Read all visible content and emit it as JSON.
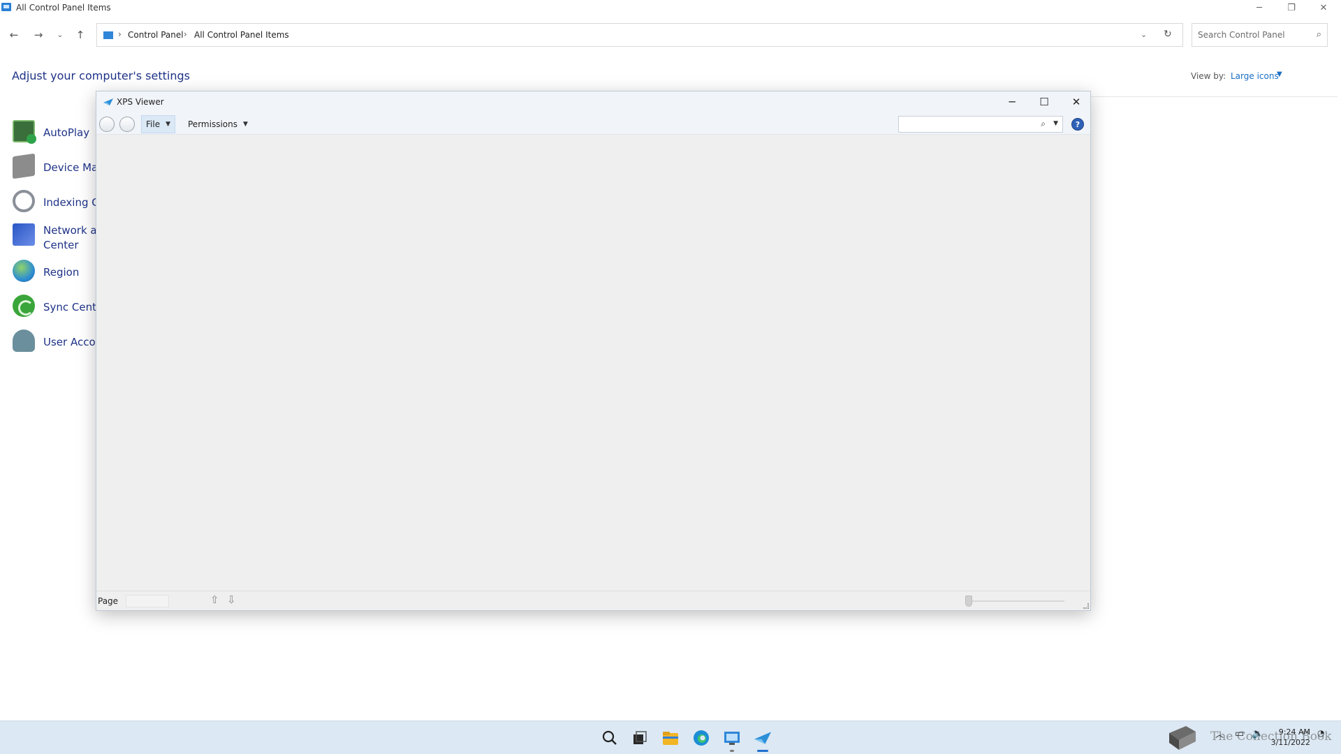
{
  "control_panel": {
    "window_title": "All Control Panel Items",
    "breadcrumb": [
      "Control Panel",
      "All Control Panel Items"
    ],
    "search_placeholder": "Search Control Panel",
    "heading": "Adjust your computer's settings",
    "view_by_label": "View by:",
    "view_by_value": "Large icons",
    "items": [
      {
        "label": "AutoPlay",
        "icon": "autoplay-icon"
      },
      {
        "label": "Device Mar",
        "icon": "device-manager-icon"
      },
      {
        "label": "Indexing O",
        "icon": "indexing-options-icon"
      },
      {
        "label": "Network ar",
        "label2": "Center",
        "icon": "network-center-icon"
      },
      {
        "label": "Region",
        "icon": "region-icon"
      },
      {
        "label": "Sync Cente",
        "icon": "sync-center-icon"
      },
      {
        "label": "User Accou",
        "icon": "user-accounts-icon"
      }
    ]
  },
  "xps_viewer": {
    "title": "XPS Viewer",
    "menu": {
      "file": "File",
      "permissions": "Permissions"
    },
    "find_value": "",
    "help_glyph": "?",
    "status": {
      "page_label": "Page",
      "page_value": ""
    }
  },
  "taskbar": {
    "icons": [
      "start-icon",
      "search-icon",
      "task-view-icon",
      "file-explorer-icon",
      "edge-icon",
      "control-panel-icon",
      "xps-viewer-icon"
    ],
    "watermark": "The Collection Book",
    "clock": {
      "time": "9:24 AM",
      "date": "3/11/2022"
    }
  },
  "colors": {
    "accent": "#1a6ec4",
    "link": "#1e3287",
    "taskbar": "#dce8f3"
  }
}
